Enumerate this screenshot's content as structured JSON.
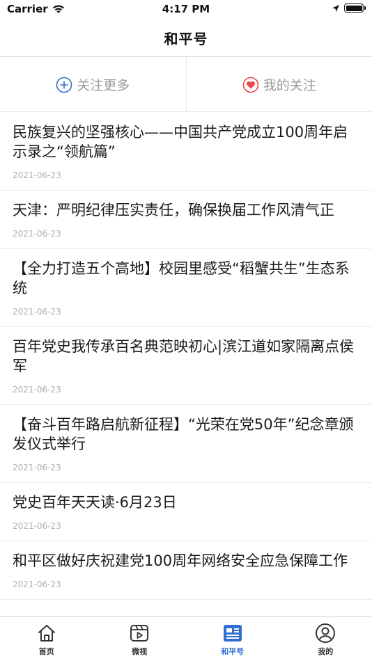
{
  "status": {
    "carrier": "Carrier",
    "time": "4:17 PM"
  },
  "nav": {
    "title": "和平号"
  },
  "actions": {
    "follow_more": "关注更多",
    "my_follows": "我的关注"
  },
  "news": [
    {
      "title": "民族复兴的坚强核心——中国共产党成立100周年启示录之“领航篇”",
      "date": "2021-06-23"
    },
    {
      "title": "天津：严明纪律压实责任，确保换届工作风清气正",
      "date": "2021-06-23"
    },
    {
      "title": "【全力打造五个高地】校园里感受“稻蟹共生”生态系统",
      "date": "2021-06-23"
    },
    {
      "title": "百年党史我传承百名典范映初心|滨江道如家隔离点侯军",
      "date": "2021-06-23"
    },
    {
      "title": "【奋斗百年路启航新征程】“光荣在党50年”纪念章颁发仪式举行",
      "date": "2021-06-23"
    },
    {
      "title": "党史百年天天读·6月23日",
      "date": "2021-06-23"
    },
    {
      "title": "和平区做好庆祝建党100周年网络安全应急保障工作",
      "date": "2021-06-23"
    }
  ],
  "tabs": {
    "home": "首页",
    "video": "微视",
    "heping": "和平号",
    "mine": "我的"
  },
  "colors": {
    "accent": "#2f6fd1",
    "heart": "#e8474c"
  }
}
